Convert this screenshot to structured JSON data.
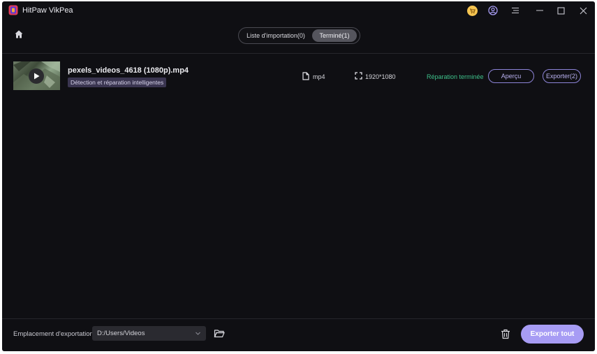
{
  "app": {
    "title": "HitPaw VikPea"
  },
  "window_controls": [
    "cart-icon",
    "user-icon",
    "menu-icon",
    "minimize-icon",
    "maximize-icon",
    "close-icon"
  ],
  "tabs": [
    {
      "label": "Liste d'importation(0)",
      "active": false
    },
    {
      "label": "Terminé(1)",
      "active": true
    }
  ],
  "files": [
    {
      "name": "pexels_videos_4618 (1080p).mp4",
      "badge": "Détection et réparation intelligentes",
      "format": "mp4",
      "resolution": "1920*1080",
      "status": "Réparation terminée",
      "preview_label": "Aperçu",
      "export_label": "Exporter(2)"
    }
  ],
  "footer": {
    "export_location_label": "Emplacement d'exportation",
    "export_path": "D:/Users/Videos",
    "export_all_label": "Exporter tout"
  },
  "colors": {
    "background": "#0f0f13",
    "accent": "#a79cf4",
    "status_success": "#3ec08a",
    "badge_bg": "#3a3550"
  }
}
